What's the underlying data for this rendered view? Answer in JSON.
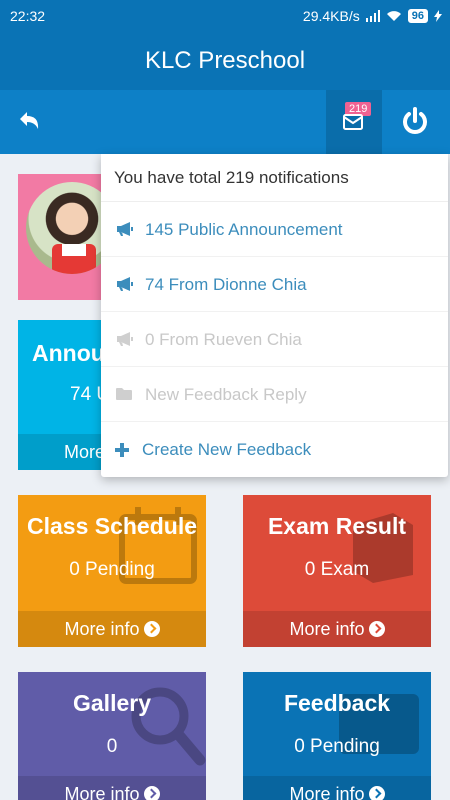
{
  "status_bar": {
    "time": "22:32",
    "net_speed": "29.4KB/s",
    "battery": "96"
  },
  "app": {
    "title": "KLC Preschool"
  },
  "toolbar": {
    "notification_count": "219"
  },
  "cards": {
    "announcement": {
      "title": "Annou",
      "value": "74 U",
      "footer": "More"
    },
    "class_schedule": {
      "title": "Class Schedule",
      "value": "0 Pending",
      "footer": "More info"
    },
    "exam_result": {
      "title": "Exam Result",
      "value": "0 Exam",
      "footer": "More info"
    },
    "gallery": {
      "title": "Gallery",
      "value": "0",
      "footer": "More info"
    },
    "feedback": {
      "title": "Feedback",
      "value": "0 Pending",
      "footer": "More info"
    }
  },
  "notifications": {
    "header": "You have total 219 notifications",
    "items": [
      {
        "label": "145 Public Announcement",
        "icon": "megaphone-icon",
        "enabled": true
      },
      {
        "label": "74 From Dionne Chia",
        "icon": "megaphone-icon",
        "enabled": true
      },
      {
        "label": "0 From Rueven Chia",
        "icon": "megaphone-icon",
        "enabled": false
      },
      {
        "label": "New Feedback Reply",
        "icon": "folder-icon",
        "enabled": false
      },
      {
        "label": "Create New Feedback",
        "icon": "plus-icon",
        "enabled": true
      }
    ]
  },
  "colors": {
    "primary": "#0a73b5",
    "toolbar": "#0d80c7",
    "link": "#3c8dbc",
    "badge": "#f06292",
    "schedule": "#f39c12",
    "exam": "#dd4b39",
    "gallery": "#605ca8",
    "announcement": "#00b4e6",
    "profile": "#f27aa4"
  }
}
